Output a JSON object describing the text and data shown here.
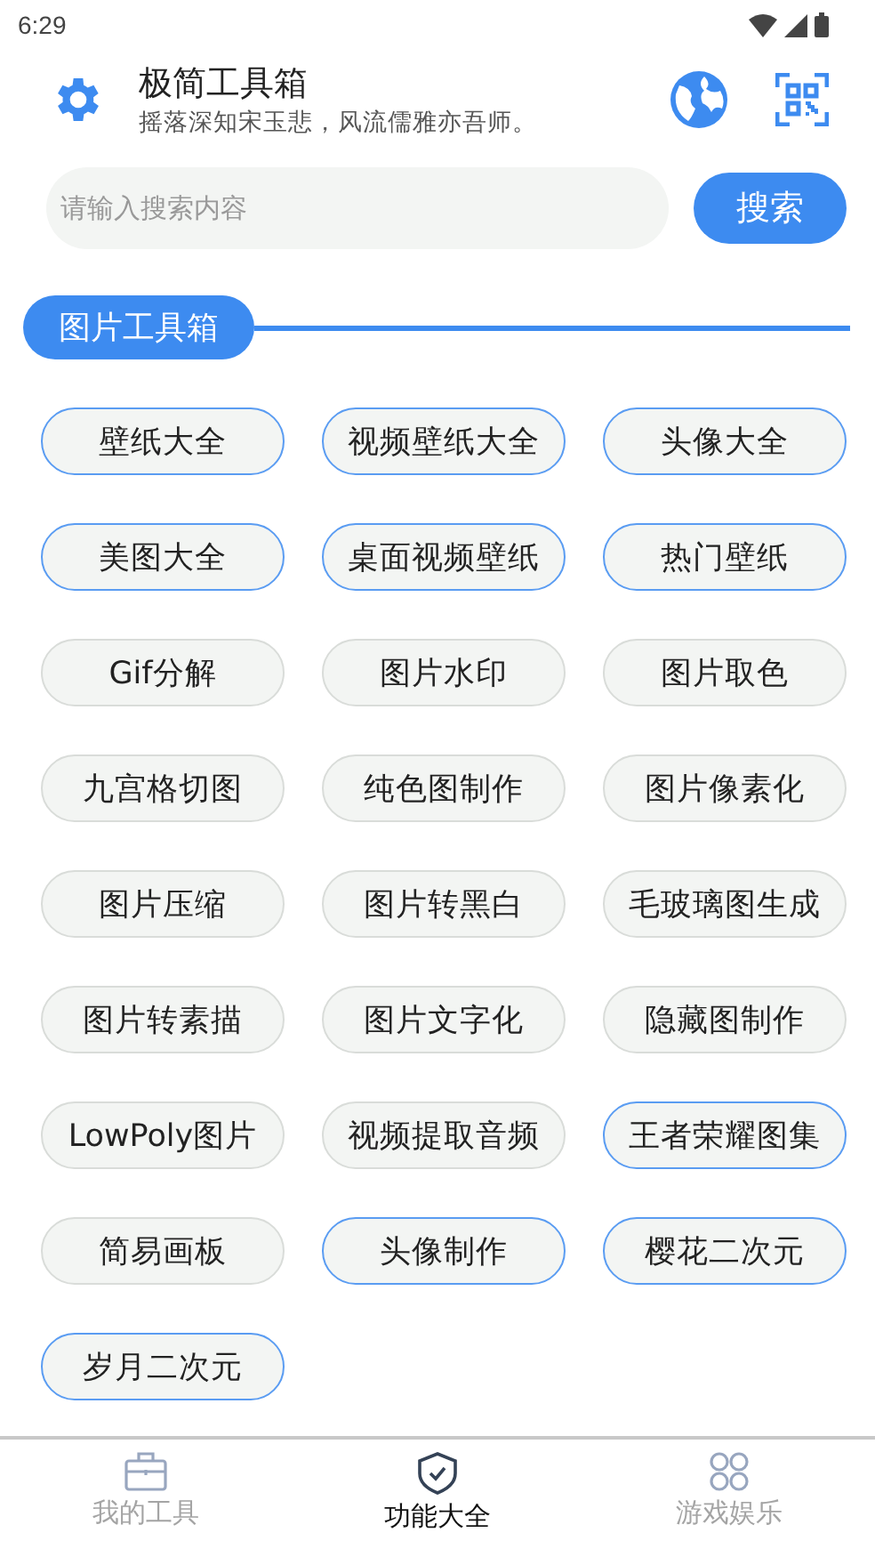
{
  "status_bar": {
    "time": "6:29"
  },
  "header": {
    "title": "极简工具箱",
    "subtitle": "摇落深知宋玉悲，风流儒雅亦吾师。"
  },
  "search": {
    "placeholder": "请输入搜索内容",
    "button": "搜索"
  },
  "section": {
    "title": "图片工具箱"
  },
  "tools": [
    {
      "label": "壁纸大全",
      "highlighted": true
    },
    {
      "label": "视频壁纸大全",
      "highlighted": true
    },
    {
      "label": "头像大全",
      "highlighted": true
    },
    {
      "label": "美图大全",
      "highlighted": true
    },
    {
      "label": "桌面视频壁纸",
      "highlighted": true
    },
    {
      "label": "热门壁纸",
      "highlighted": true
    },
    {
      "label": "Gif分解",
      "highlighted": false
    },
    {
      "label": "图片水印",
      "highlighted": false
    },
    {
      "label": "图片取色",
      "highlighted": false
    },
    {
      "label": "九宫格切图",
      "highlighted": false
    },
    {
      "label": "纯色图制作",
      "highlighted": false
    },
    {
      "label": "图片像素化",
      "highlighted": false
    },
    {
      "label": "图片压缩",
      "highlighted": false
    },
    {
      "label": "图片转黑白",
      "highlighted": false
    },
    {
      "label": "毛玻璃图生成",
      "highlighted": false
    },
    {
      "label": "图片转素描",
      "highlighted": false
    },
    {
      "label": "图片文字化",
      "highlighted": false
    },
    {
      "label": "隐藏图制作",
      "highlighted": false
    },
    {
      "label": "LowPoly图片",
      "highlighted": false
    },
    {
      "label": "视频提取音频",
      "highlighted": false
    },
    {
      "label": "王者荣耀图集",
      "highlighted": true
    },
    {
      "label": "简易画板",
      "highlighted": false
    },
    {
      "label": "头像制作",
      "highlighted": true
    },
    {
      "label": "樱花二次元",
      "highlighted": true
    },
    {
      "label": "岁月二次元",
      "highlighted": true
    }
  ],
  "bottom_nav": [
    {
      "kind": "toolbox",
      "label": "我的工具",
      "selected": false
    },
    {
      "kind": "shield",
      "label": "功能大全",
      "selected": true
    },
    {
      "kind": "grid",
      "label": "游戏娱乐",
      "selected": false
    }
  ]
}
